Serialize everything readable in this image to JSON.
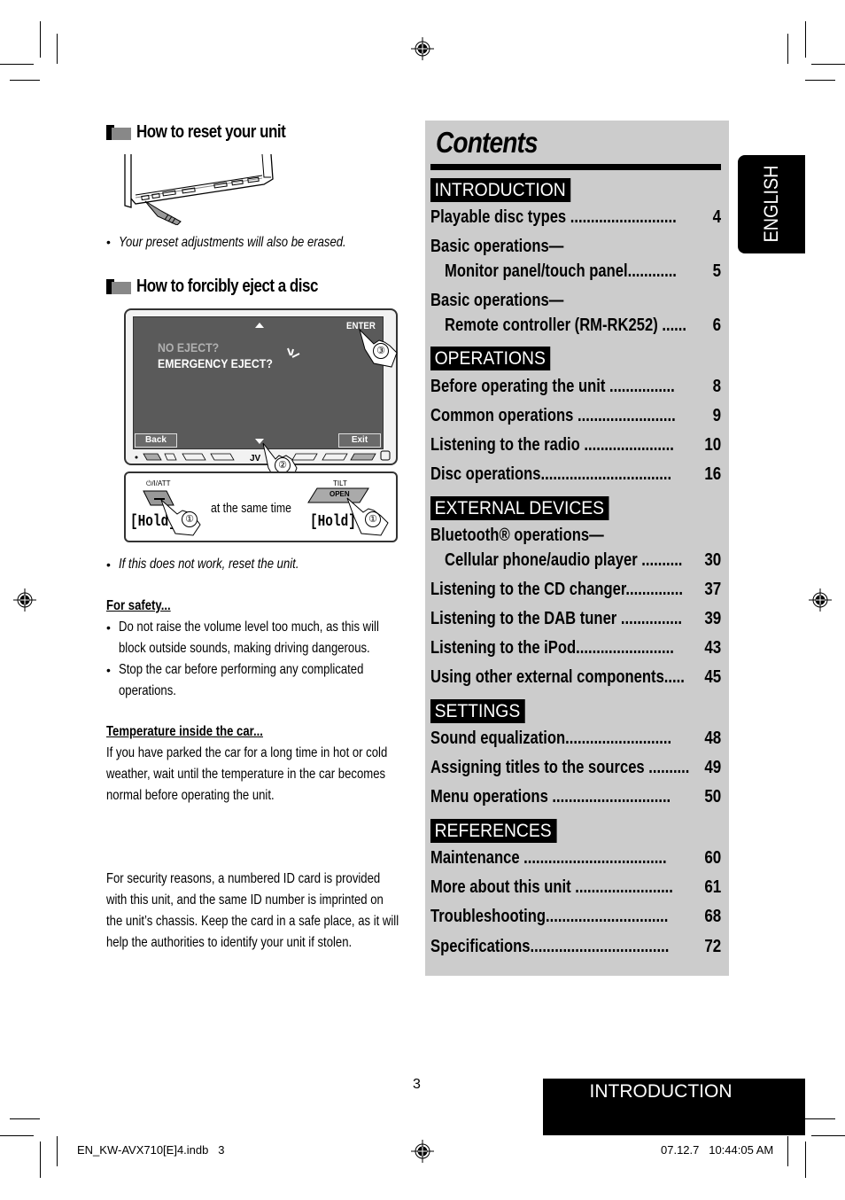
{
  "left": {
    "reset": {
      "title": "How to reset your unit",
      "note": "Your preset adjustments will also be erased."
    },
    "eject": {
      "title": "How to forcibly eject a disc",
      "screen": {
        "line1": "NO EJECT?",
        "line2": "EMERGENCY EJECT?",
        "enter": "ENTER",
        "back": "Back",
        "exit": "Exit"
      },
      "buttons": {
        "power_label": "⏻/I/ATT",
        "tilt_label": "TILT",
        "open_label": "OPEN",
        "hold_left": "[Hold]",
        "hold_right": "[Hold]",
        "same_time": "at the same time",
        "step1": "①",
        "step2": "②",
        "step3": "③"
      },
      "note": "If this does not work, reset the unit."
    },
    "safety": {
      "heading": "For safety...",
      "bullets": [
        [
          "Do not raise the volume level too much, as this will",
          "block outside sounds, making driving dangerous."
        ],
        [
          "Stop the car before performing any complicated",
          "operations."
        ]
      ]
    },
    "temperature": {
      "heading": "Temperature inside the car...",
      "lines": [
        "If you have parked the car for a long time in hot or cold",
        "weather, wait until the temperature in the car becomes",
        "normal before operating the unit."
      ]
    },
    "security": {
      "lines": [
        "For security reasons, a numbered ID card is provided",
        "with this unit, and the same ID number is imprinted on",
        "the unit’s chassis. Keep the card in a safe place, as it will",
        "help the authorities to identify your unit if stolen."
      ]
    }
  },
  "contents": {
    "title": "Contents",
    "sections": [
      {
        "name": "INTRODUCTION",
        "entries": [
          {
            "label": "Playable disc types ..........................",
            "page": "4"
          },
          {
            "label": "Basic operations—",
            "page": ""
          },
          {
            "label": "Monitor panel/touch panel............",
            "page": "5",
            "sub": true
          },
          {
            "label": "Basic operations—",
            "page": ""
          },
          {
            "label": "Remote controller (RM-RK252) ......",
            "page": "6",
            "sub": true
          }
        ]
      },
      {
        "name": "OPERATIONS",
        "entries": [
          {
            "label": "Before operating the unit ................",
            "page": "8"
          },
          {
            "label": "Common operations ........................",
            "page": "9"
          },
          {
            "label": "Listening to the radio ......................",
            "page": "10"
          },
          {
            "label": "Disc operations................................",
            "page": "16"
          }
        ]
      },
      {
        "name": "EXTERNAL DEVICES",
        "entries": [
          {
            "label": "Bluetooth® operations—",
            "page": ""
          },
          {
            "label": "Cellular phone/audio player ..........",
            "page": "30",
            "sub": true
          },
          {
            "label": "Listening to the CD changer..............",
            "page": "37"
          },
          {
            "label": "Listening to the DAB tuner ...............",
            "page": "39"
          },
          {
            "label": "Listening to the iPod........................",
            "page": "43"
          },
          {
            "label": "Using other external components.....",
            "page": "45"
          }
        ]
      },
      {
        "name": "SETTINGS",
        "entries": [
          {
            "label": "Sound equalization..........................",
            "page": "48"
          },
          {
            "label": "Assigning titles to the sources ..........",
            "page": "49"
          },
          {
            "label": "Menu operations .............................",
            "page": "50"
          }
        ]
      },
      {
        "name": "REFERENCES",
        "entries": [
          {
            "label": "Maintenance ...................................",
            "page": "60"
          },
          {
            "label": "More about this unit ........................",
            "page": "61"
          },
          {
            "label": "Troubleshooting..............................",
            "page": "68"
          },
          {
            "label": "Specifications..................................",
            "page": "72"
          }
        ]
      }
    ]
  },
  "language_tab": "ENGLISH",
  "footer": {
    "page_number": "3",
    "section_tab": "INTRODUCTION",
    "file_slug": "EN_KW-AVX710[E]4.indb   3",
    "timestamp": "07.12.7   10:44:05 AM"
  }
}
